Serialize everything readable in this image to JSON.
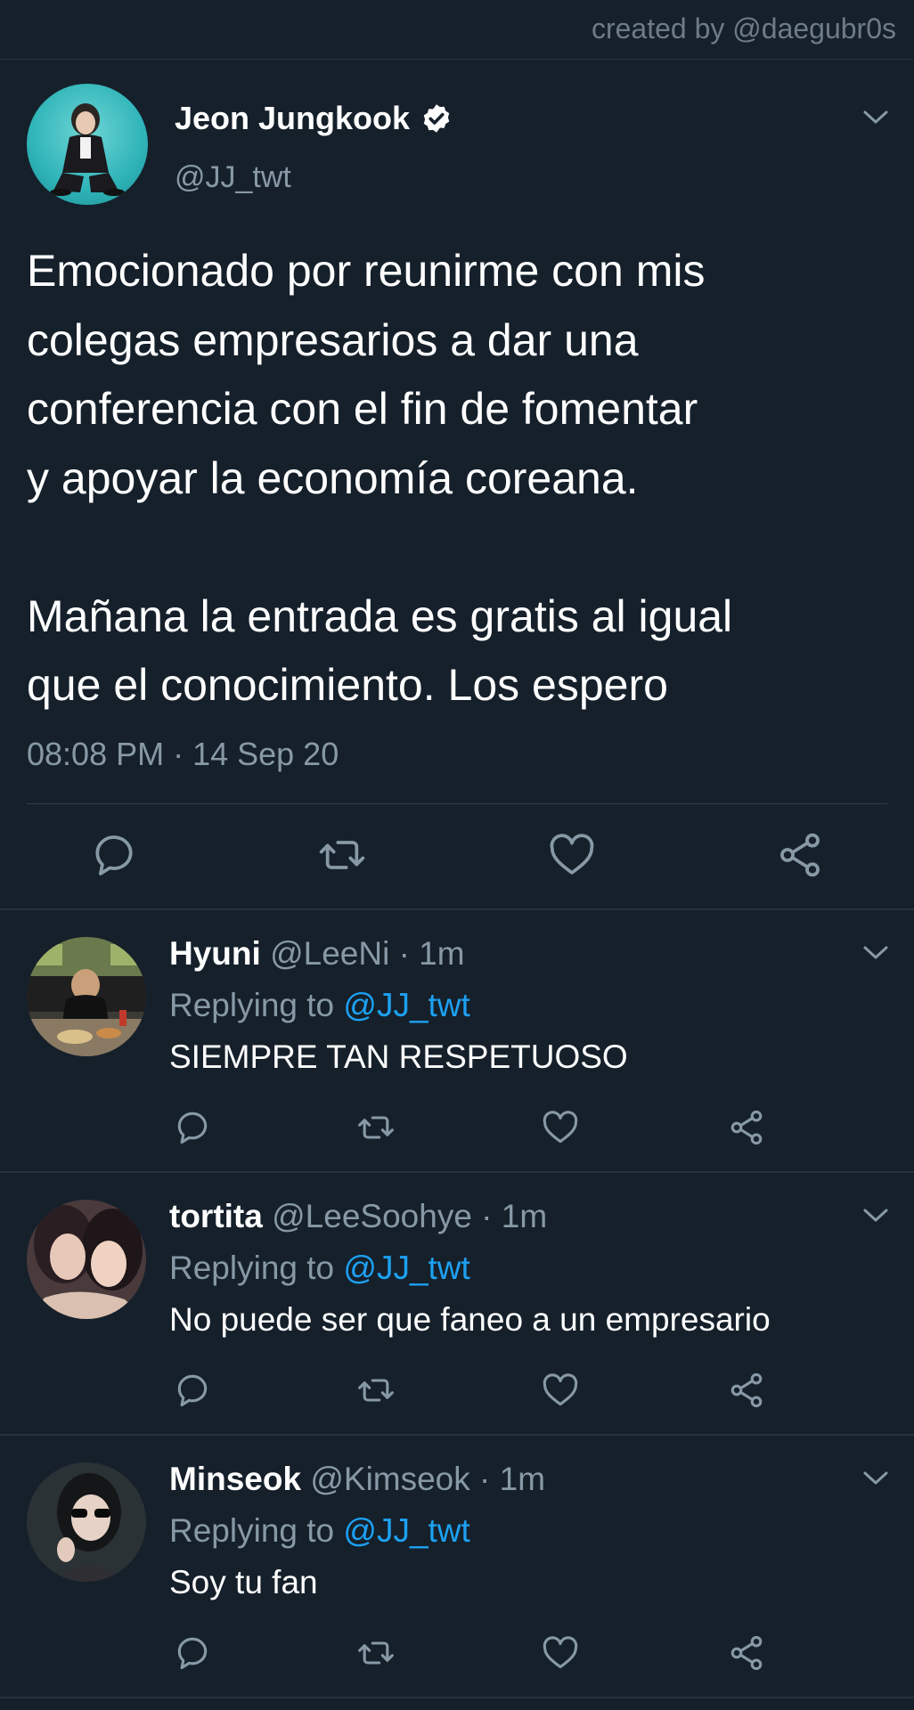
{
  "credit": "created by @daegubr0s",
  "tweet": {
    "name": "Jeon Jungkook",
    "handle": "@JJ_twt",
    "text": "Emocionado por reunirme con mis\ncolegas empresarios a dar una\nconferencia con el fin de fomentar\ny apoyar la economía coreana.\n\nMañana la entrada es gratis al igual\nque el conocimiento. Los espero",
    "timestamp": "08:08 PM · 14 Sep 20"
  },
  "replies": [
    {
      "name": "Hyuni",
      "meta": "@LeeNi · 1m",
      "replying_prefix": "Replying to ",
      "mention": "@JJ_twt",
      "text": "SIEMPRE TAN RESPETUOSO"
    },
    {
      "name": "tortita",
      "meta": "@LeeSoohye · 1m",
      "replying_prefix": "Replying to ",
      "mention": "@JJ_twt",
      "text": "No puede ser que faneo a un empresario"
    },
    {
      "name": "Minseok",
      "meta": "@Kimseok · 1m",
      "replying_prefix": "Replying to ",
      "mention": "@JJ_twt",
      "text": "Soy tu fan"
    }
  ],
  "icons": {
    "reply": "reply-icon",
    "retweet": "retweet-icon",
    "like": "like-icon",
    "share": "share-icon",
    "more": "chevron-down-icon",
    "verified": "verified-badge-icon"
  },
  "colors": {
    "background": "#15202b",
    "text": "#ffffff",
    "secondary": "#8899a6",
    "link": "#1da1f2"
  }
}
